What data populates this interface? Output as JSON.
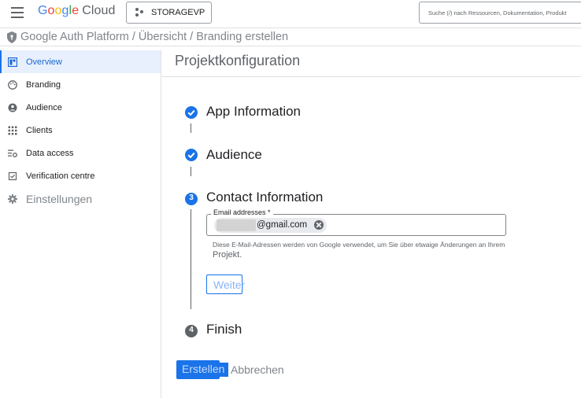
{
  "header": {
    "logo_letters": [
      "G",
      "o",
      "o",
      "g",
      "l",
      "e"
    ],
    "logo_product": "Cloud",
    "project_name": "STORAGEVP",
    "search_placeholder": "Suche (/) nach Ressourcen, Dokumentation, Produkt"
  },
  "breadcrumb": {
    "text": "Google Auth Platform / Übersicht / Branding erstellen"
  },
  "sidebar": {
    "items": [
      {
        "label": "Overview",
        "icon": "dashboard-icon",
        "active": true
      },
      {
        "label": "Branding",
        "icon": "palette-icon"
      },
      {
        "label": "Audience",
        "icon": "person-icon"
      },
      {
        "label": "Clients",
        "icon": "grid-icon"
      },
      {
        "label": "Data access",
        "icon": "data-access-icon"
      },
      {
        "label": "Verification centre",
        "icon": "checkbox-icon"
      },
      {
        "label": "Einstellungen",
        "icon": "gear-icon"
      }
    ]
  },
  "main": {
    "title": "Projektkonfiguration",
    "steps": [
      {
        "label": "App Information",
        "state": "done"
      },
      {
        "label": "Audience",
        "state": "done"
      },
      {
        "label": "Contact Information",
        "state": "active",
        "number": "3"
      },
      {
        "label": "Finish",
        "state": "pending",
        "number": "4"
      }
    ],
    "email_field": {
      "label": "Email addresses *",
      "chip_text": "@gmail.com"
    },
    "helper_line1": "Diese E-Mail-Adressen werden von Google verwendet, um Sie über etwaige Änderungen an Ihrem",
    "helper_line2": "Projekt.",
    "next_button": "Weiter",
    "create_button": "Erstellen",
    "cancel_button": "Abbrechen"
  },
  "colors": {
    "accent": "#1a73e8",
    "active_bg": "#e8f0fe",
    "muted_text": "#80868b"
  }
}
